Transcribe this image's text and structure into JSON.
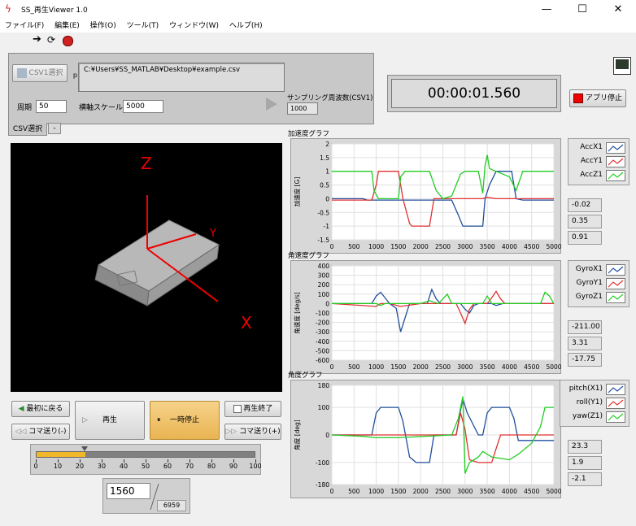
{
  "window": {
    "title": "SS_再生Viewer 1.0",
    "min": "—",
    "max": "☐",
    "close": "✕"
  },
  "menu": [
    "ファイル(F)",
    "編集(E)",
    "操作(O)",
    "ツール(T)",
    "ウィンドウ(W)",
    "ヘルプ(H)"
  ],
  "csv": {
    "select_button": "CSV1選択",
    "path": "C:¥Users¥SS_MATLAB¥Desktop¥example.csv",
    "period_label": "周期",
    "period_value": "50",
    "xscale_label": "横軸スケール",
    "xscale_value": "5000",
    "sampling_label": "サンプリング周波数(CSV1)",
    "sampling_value": "1000",
    "tab_label": "CSV選択",
    "tab_minus": "-"
  },
  "timer": {
    "value": "00:00:01.560"
  },
  "app_stop_button": "アプリ停止",
  "scene": {
    "axis_z": "Z",
    "axis_y": "Y",
    "axis_x": "X"
  },
  "playback": {
    "back_to_start": "最初に戻る",
    "play": "再生",
    "pause": "一時停止",
    "end_play": "再生終了",
    "step_back": "コマ送り(-)",
    "step_fwd": "コマ送り(+)",
    "slider_ticks": [
      "0",
      "10",
      "20",
      "30",
      "40",
      "50",
      "60",
      "70",
      "80",
      "90",
      "100"
    ],
    "slider_position": 22.4,
    "frame_value": "1560",
    "frame_total": "6959"
  },
  "graphs": [
    {
      "title": "加速度グラフ",
      "ylabel": "加速度 [G]",
      "yticks": [
        "2",
        "1.5",
        "1",
        "0.5",
        "0",
        "-0.5",
        "-1",
        "-1.5"
      ],
      "ymin": -1.5,
      "ymax": 2,
      "xticks": [
        "0",
        "500",
        "1000",
        "1500",
        "2000",
        "2500",
        "3000",
        "3500",
        "4000",
        "4500",
        "5000"
      ],
      "legend": [
        "AccX1",
        "AccY1",
        "AccZ1"
      ],
      "values": [
        "-0.02",
        "0.35",
        "0.91"
      ],
      "series": [
        {
          "color": "#1f4e9c",
          "points": [
            [
              0,
              0
            ],
            [
              700,
              0
            ],
            [
              800,
              -0.05
            ],
            [
              1000,
              -0.05
            ],
            [
              1500,
              -0.05
            ],
            [
              2500,
              -0.05
            ],
            [
              2700,
              -0.05
            ],
            [
              2850,
              -0.6
            ],
            [
              2950,
              -1
            ],
            [
              3400,
              -1
            ],
            [
              3450,
              0
            ],
            [
              3550,
              0.5
            ],
            [
              3700,
              1
            ],
            [
              4050,
              1
            ],
            [
              4150,
              0
            ],
            [
              4300,
              -0.05
            ],
            [
              5000,
              -0.05
            ]
          ]
        },
        {
          "color": "#e03030",
          "points": [
            [
              0,
              -0.05
            ],
            [
              900,
              -0.05
            ],
            [
              1000,
              0.5
            ],
            [
              1050,
              1
            ],
            [
              1500,
              1
            ],
            [
              1600,
              0
            ],
            [
              1750,
              -0.9
            ],
            [
              1800,
              -1
            ],
            [
              2200,
              -1
            ],
            [
              2300,
              0
            ],
            [
              2500,
              0
            ],
            [
              3000,
              0
            ],
            [
              3400,
              0
            ],
            [
              3500,
              0.05
            ],
            [
              3700,
              0
            ],
            [
              5000,
              0
            ]
          ]
        },
        {
          "color": "#22cc22",
          "points": [
            [
              0,
              1
            ],
            [
              700,
              1
            ],
            [
              900,
              1
            ],
            [
              950,
              0.3
            ],
            [
              1050,
              0
            ],
            [
              1500,
              0
            ],
            [
              1550,
              0.8
            ],
            [
              1650,
              1
            ],
            [
              2200,
              1
            ],
            [
              2350,
              0.3
            ],
            [
              2500,
              0
            ],
            [
              2700,
              0.1
            ],
            [
              2900,
              0.9
            ],
            [
              3000,
              1
            ],
            [
              3300,
              1
            ],
            [
              3400,
              0.2
            ],
            [
              3450,
              1.2
            ],
            [
              3500,
              1.6
            ],
            [
              3550,
              1.1
            ],
            [
              3700,
              1
            ],
            [
              4000,
              0.8
            ],
            [
              4150,
              0.3
            ],
            [
              4300,
              1
            ],
            [
              5000,
              1
            ]
          ]
        }
      ]
    },
    {
      "title": "角速度グラフ",
      "ylabel": "角速度 [deg/s]",
      "yticks": [
        "400",
        "300",
        "200",
        "100",
        "0",
        "-100",
        "-200",
        "-300",
        "-400",
        "-500",
        "-600"
      ],
      "ymin": -600,
      "ymax": 400,
      "xticks": [
        "0",
        "500",
        "1000",
        "1500",
        "2000",
        "2500",
        "3000",
        "3500",
        "4000",
        "4500",
        "5000"
      ],
      "legend": [
        "GyroX1",
        "GyroY1",
        "GyroZ1"
      ],
      "values": [
        "-211.00",
        "3.31",
        "-17.75"
      ],
      "series": [
        {
          "color": "#1f4e9c",
          "points": [
            [
              0,
              0
            ],
            [
              900,
              0
            ],
            [
              1000,
              80
            ],
            [
              1100,
              120
            ],
            [
              1200,
              60
            ],
            [
              1300,
              0
            ],
            [
              1450,
              -50
            ],
            [
              1550,
              -300
            ],
            [
              1650,
              -150
            ],
            [
              1750,
              0
            ],
            [
              2150,
              0
            ],
            [
              2250,
              150
            ],
            [
              2350,
              50
            ],
            [
              2450,
              0
            ],
            [
              2900,
              0
            ],
            [
              3000,
              -60
            ],
            [
              3100,
              -100
            ],
            [
              3200,
              -20
            ],
            [
              3300,
              0
            ],
            [
              3600,
              0
            ],
            [
              3700,
              -20
            ],
            [
              3850,
              0
            ],
            [
              5000,
              0
            ]
          ]
        },
        {
          "color": "#e03030",
          "points": [
            [
              0,
              0
            ],
            [
              1000,
              -30
            ],
            [
              1100,
              0
            ],
            [
              1300,
              0
            ],
            [
              1550,
              -30
            ],
            [
              2000,
              0
            ],
            [
              2800,
              0
            ],
            [
              2900,
              -100
            ],
            [
              3000,
              -210
            ],
            [
              3100,
              -60
            ],
            [
              3200,
              0
            ],
            [
              3500,
              0
            ],
            [
              3600,
              60
            ],
            [
              3700,
              130
            ],
            [
              3800,
              50
            ],
            [
              3900,
              0
            ],
            [
              5000,
              0
            ]
          ]
        },
        {
          "color": "#22cc22",
          "points": [
            [
              0,
              0
            ],
            [
              1000,
              0
            ],
            [
              1100,
              -20
            ],
            [
              1200,
              0
            ],
            [
              2000,
              0
            ],
            [
              2200,
              30
            ],
            [
              2400,
              0
            ],
            [
              2600,
              100
            ],
            [
              2700,
              0
            ],
            [
              3400,
              0
            ],
            [
              3500,
              80
            ],
            [
              3600,
              0
            ],
            [
              4700,
              0
            ],
            [
              4800,
              120
            ],
            [
              4900,
              80
            ],
            [
              5000,
              0
            ]
          ]
        }
      ]
    },
    {
      "title": "角度グラフ",
      "ylabel": "角度 [deg]",
      "yticks": [
        "180",
        "100",
        "0",
        "-100",
        "-180"
      ],
      "ymin": -180,
      "ymax": 180,
      "xticks": [
        "0",
        "500",
        "1000",
        "1500",
        "2000",
        "2500",
        "3000",
        "3500",
        "4000",
        "4500",
        "5000"
      ],
      "legend": [
        "pitch(X1)",
        "roll(Y1)",
        "yaw(Z1)"
      ],
      "values": [
        "23.3",
        "1.9",
        "-2.1"
      ],
      "series": [
        {
          "color": "#1f4e9c",
          "points": [
            [
              0,
              0
            ],
            [
              900,
              0
            ],
            [
              1000,
              80
            ],
            [
              1100,
              100
            ],
            [
              1500,
              100
            ],
            [
              1600,
              50
            ],
            [
              1750,
              -80
            ],
            [
              1900,
              -100
            ],
            [
              2200,
              -100
            ],
            [
              2300,
              0
            ],
            [
              2800,
              0
            ],
            [
              2900,
              90
            ],
            [
              2950,
              130
            ],
            [
              3050,
              80
            ],
            [
              3300,
              0
            ],
            [
              3400,
              0
            ],
            [
              3500,
              80
            ],
            [
              3600,
              100
            ],
            [
              4000,
              100
            ],
            [
              4100,
              60
            ],
            [
              4200,
              -20
            ],
            [
              5000,
              -20
            ]
          ]
        },
        {
          "color": "#e03030",
          "points": [
            [
              0,
              0
            ],
            [
              2700,
              0
            ],
            [
              2800,
              0
            ],
            [
              2900,
              80
            ],
            [
              3000,
              20
            ],
            [
              3100,
              -90
            ],
            [
              3300,
              -100
            ],
            [
              3600,
              -100
            ],
            [
              3700,
              -50
            ],
            [
              3800,
              0
            ],
            [
              5000,
              0
            ]
          ]
        },
        {
          "color": "#22cc22",
          "points": [
            [
              0,
              0
            ],
            [
              700,
              -5
            ],
            [
              1000,
              -10
            ],
            [
              1500,
              -10
            ],
            [
              2700,
              0
            ],
            [
              2850,
              60
            ],
            [
              2950,
              140
            ],
            [
              3000,
              -140
            ],
            [
              3100,
              -100
            ],
            [
              3300,
              -80
            ],
            [
              3400,
              -60
            ],
            [
              3500,
              -70
            ],
            [
              3600,
              -80
            ],
            [
              4000,
              -90
            ],
            [
              4200,
              -70
            ],
            [
              4500,
              -30
            ],
            [
              4700,
              30
            ],
            [
              4800,
              100
            ],
            [
              5000,
              100
            ]
          ]
        }
      ]
    }
  ]
}
